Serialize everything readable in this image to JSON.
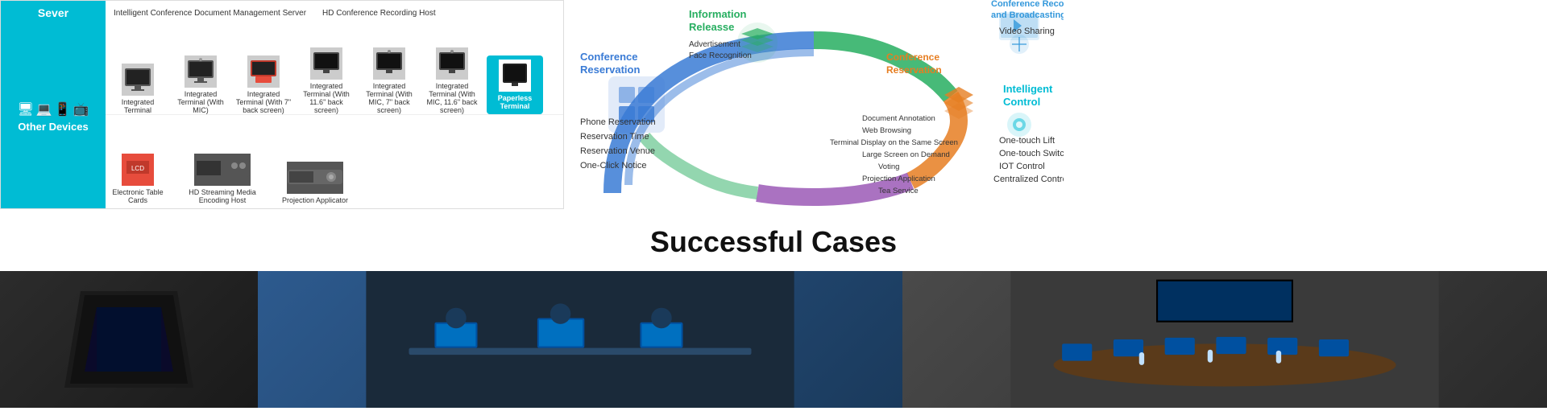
{
  "colors": {
    "teal": "#00bcd4",
    "blue": "#3a7bd5",
    "green": "#27ae60",
    "orange": "#e67e22",
    "red": "#c0392b",
    "purple": "#8e44ad",
    "light_blue": "#3498db"
  },
  "server": {
    "label": "Sever",
    "items": [
      "Intelligent Conference Document Management Server",
      "HD Conference Recording Host"
    ]
  },
  "devices": [
    {
      "name": "Integrated Terminal",
      "type": "monitor"
    },
    {
      "name": "Integrated Terminal (With MIC)",
      "type": "monitor"
    },
    {
      "name": "Integrated Terminal (With 7\" back screen)",
      "type": "monitor"
    },
    {
      "name": "Integrated Terminal (With 11.6\" back screen)",
      "type": "monitor"
    },
    {
      "name": "Integrated Terminal (With MIC, 7\" back screen)",
      "type": "monitor"
    },
    {
      "name": "Integrated Terminal (With MIC, 11.6\" back screen)",
      "type": "monitor"
    },
    {
      "name": "Paperless Terminal",
      "type": "teal"
    }
  ],
  "other_devices": {
    "label": "Other Devices",
    "items": [
      "Electronic Table Cards",
      "HD Streaming Media Encoding Host",
      "Projection Applicator"
    ]
  },
  "diagram": {
    "sections": [
      {
        "id": "conference-reservation",
        "label": "Conference Reservation",
        "color": "#3a7bd5",
        "features": [
          "Phone Reservation",
          "Reservation Time",
          "Reservation Venue",
          "One-Click Notice"
        ]
      },
      {
        "id": "information-release",
        "label": "Information Releasse",
        "color": "#27ae60",
        "features": [
          "Advertisement",
          "Face Recognition"
        ]
      },
      {
        "id": "conference-reservation2",
        "label": "Conference Reservation",
        "color": "#e67e22",
        "features": [
          "Document Annotation",
          "Web Browsing",
          "Terminal Display on the Same Screen",
          "Large Screen on Demand",
          "Voting",
          "Projection Application",
          "Tea Service"
        ]
      },
      {
        "id": "conference-recording",
        "label": "Conference Recording and Broadcasting",
        "color": "#3498db",
        "features": [
          "Video Sharing"
        ]
      },
      {
        "id": "intelligent-control",
        "label": "Intelligent Control",
        "color": "#00bcd4",
        "features": [
          "One-touch Lift",
          "One-touch Switch",
          "IOT Control",
          "Centralized Control"
        ]
      }
    ]
  },
  "successful_cases": {
    "title": "Successful Cases"
  }
}
